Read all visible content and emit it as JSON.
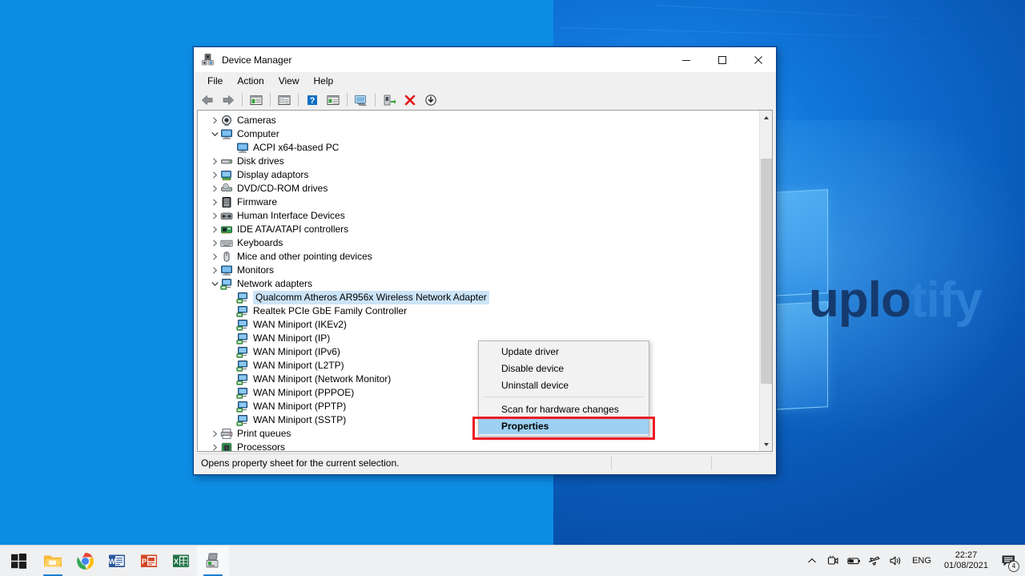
{
  "desktop": {
    "watermark_dark": "uplo",
    "watermark_light": "tify"
  },
  "window": {
    "title": "Device Manager",
    "icon": "device-manager-icon",
    "controls": {
      "minimize": "minimize-icon",
      "maximize": "maximize-icon",
      "close": "close-icon"
    },
    "menubar": [
      "File",
      "Action",
      "View",
      "Help"
    ],
    "toolbar": [
      {
        "name": "back-button",
        "icon": "back-arrow-icon"
      },
      {
        "name": "forward-button",
        "icon": "forward-arrow-icon"
      },
      {
        "name": "separator-1",
        "icon": "separator"
      },
      {
        "name": "properties-pane-button",
        "icon": "properties-pane-icon"
      },
      {
        "name": "separator-2",
        "icon": "separator"
      },
      {
        "name": "show-details-button",
        "icon": "details-icon"
      },
      {
        "name": "separator-3",
        "icon": "separator"
      },
      {
        "name": "help-button",
        "icon": "help-icon"
      },
      {
        "name": "properties-button",
        "icon": "properties-icon"
      },
      {
        "name": "separator-4",
        "icon": "separator"
      },
      {
        "name": "scan-hardware-button",
        "icon": "scan-computer-icon"
      },
      {
        "name": "separator-5",
        "icon": "separator"
      },
      {
        "name": "update-driver-button",
        "icon": "update-driver-icon"
      },
      {
        "name": "uninstall-device-button",
        "icon": "red-x-icon"
      },
      {
        "name": "disable-device-button",
        "icon": "download-arrow-icon"
      }
    ],
    "statusbar": "Opens property sheet for the current selection."
  },
  "tree": [
    {
      "label": "Cameras",
      "indent": 0,
      "expander": "collapsed",
      "icon": "camera-icon",
      "selected": false
    },
    {
      "label": "Computer",
      "indent": 0,
      "expander": "expanded",
      "icon": "monitor-icon",
      "selected": false
    },
    {
      "label": "ACPI x64-based PC",
      "indent": 1,
      "expander": "none",
      "icon": "monitor-icon",
      "selected": false
    },
    {
      "label": "Disk drives",
      "indent": 0,
      "expander": "collapsed",
      "icon": "disk-icon",
      "selected": false
    },
    {
      "label": "Display adaptors",
      "indent": 0,
      "expander": "collapsed",
      "icon": "display-adapter-icon",
      "selected": false
    },
    {
      "label": "DVD/CD-ROM drives",
      "indent": 0,
      "expander": "collapsed",
      "icon": "optical-drive-icon",
      "selected": false
    },
    {
      "label": "Firmware",
      "indent": 0,
      "expander": "collapsed",
      "icon": "firmware-icon",
      "selected": false
    },
    {
      "label": "Human Interface Devices",
      "indent": 0,
      "expander": "collapsed",
      "icon": "hid-icon",
      "selected": false
    },
    {
      "label": "IDE ATA/ATAPI controllers",
      "indent": 0,
      "expander": "collapsed",
      "icon": "ide-controller-icon",
      "selected": false
    },
    {
      "label": "Keyboards",
      "indent": 0,
      "expander": "collapsed",
      "icon": "keyboard-icon",
      "selected": false
    },
    {
      "label": "Mice and other pointing devices",
      "indent": 0,
      "expander": "collapsed",
      "icon": "mouse-icon",
      "selected": false
    },
    {
      "label": "Monitors",
      "indent": 0,
      "expander": "collapsed",
      "icon": "monitor-icon",
      "selected": false
    },
    {
      "label": "Network adapters",
      "indent": 0,
      "expander": "expanded",
      "icon": "network-adapter-icon",
      "selected": false
    },
    {
      "label": "Qualcomm Atheros AR956x Wireless Network Adapter",
      "indent": 1,
      "expander": "none",
      "icon": "network-adapter-icon",
      "selected": true
    },
    {
      "label": "Realtek PCIe GbE Family Controller",
      "indent": 1,
      "expander": "none",
      "icon": "network-adapter-icon",
      "selected": false
    },
    {
      "label": "WAN Miniport (IKEv2)",
      "indent": 1,
      "expander": "none",
      "icon": "network-adapter-icon",
      "selected": false
    },
    {
      "label": "WAN Miniport (IP)",
      "indent": 1,
      "expander": "none",
      "icon": "network-adapter-icon",
      "selected": false
    },
    {
      "label": "WAN Miniport (IPv6)",
      "indent": 1,
      "expander": "none",
      "icon": "network-adapter-icon",
      "selected": false
    },
    {
      "label": "WAN Miniport (L2TP)",
      "indent": 1,
      "expander": "none",
      "icon": "network-adapter-icon",
      "selected": false
    },
    {
      "label": "WAN Miniport (Network Monitor)",
      "indent": 1,
      "expander": "none",
      "icon": "network-adapter-icon",
      "selected": false
    },
    {
      "label": "WAN Miniport (PPPOE)",
      "indent": 1,
      "expander": "none",
      "icon": "network-adapter-icon",
      "selected": false
    },
    {
      "label": "WAN Miniport (PPTP)",
      "indent": 1,
      "expander": "none",
      "icon": "network-adapter-icon",
      "selected": false
    },
    {
      "label": "WAN Miniport (SSTP)",
      "indent": 1,
      "expander": "none",
      "icon": "network-adapter-icon",
      "selected": false
    },
    {
      "label": "Print queues",
      "indent": 0,
      "expander": "collapsed",
      "icon": "printer-icon",
      "selected": false
    },
    {
      "label": "Processors",
      "indent": 0,
      "expander": "collapsed",
      "icon": "processor-icon",
      "selected": false
    }
  ],
  "context_menu": [
    {
      "label": "Update driver",
      "type": "item",
      "highlighted": false,
      "bold": false
    },
    {
      "label": "Disable device",
      "type": "item",
      "highlighted": false,
      "bold": false
    },
    {
      "label": "Uninstall device",
      "type": "item",
      "highlighted": false,
      "bold": false
    },
    {
      "label": "",
      "type": "separator",
      "highlighted": false,
      "bold": false
    },
    {
      "label": "Scan for hardware changes",
      "type": "item",
      "highlighted": false,
      "bold": false
    },
    {
      "label": "Properties",
      "type": "item",
      "highlighted": true,
      "bold": true
    }
  ],
  "annotation": {
    "color": "#ec1c24",
    "target": "Properties"
  },
  "taskbar": {
    "apps": [
      {
        "name": "start-button",
        "icon": "windows-logo-icon",
        "active": false,
        "running": false
      },
      {
        "name": "file-explorer-button",
        "icon": "file-explorer-icon",
        "active": false,
        "running": true
      },
      {
        "name": "chrome-button",
        "icon": "chrome-icon",
        "active": false,
        "running": true
      },
      {
        "name": "word-button",
        "icon": "word-icon",
        "active": false,
        "running": false
      },
      {
        "name": "powerpoint-button",
        "icon": "powerpoint-icon",
        "active": false,
        "running": false
      },
      {
        "name": "excel-button",
        "icon": "excel-icon",
        "active": false,
        "running": false
      },
      {
        "name": "device-manager-button",
        "icon": "device-manager-icon",
        "active": true,
        "running": true
      }
    ],
    "tray": {
      "show_hidden": "chevron-up-icon",
      "icons": [
        "screen-capture-icon",
        "battery-icon",
        "airplane-mode-icon",
        "volume-icon"
      ],
      "language": "ENG",
      "time": "22:27",
      "date": "01/08/2021",
      "notification_icon": "notification-icon",
      "notification_count": "4"
    }
  }
}
